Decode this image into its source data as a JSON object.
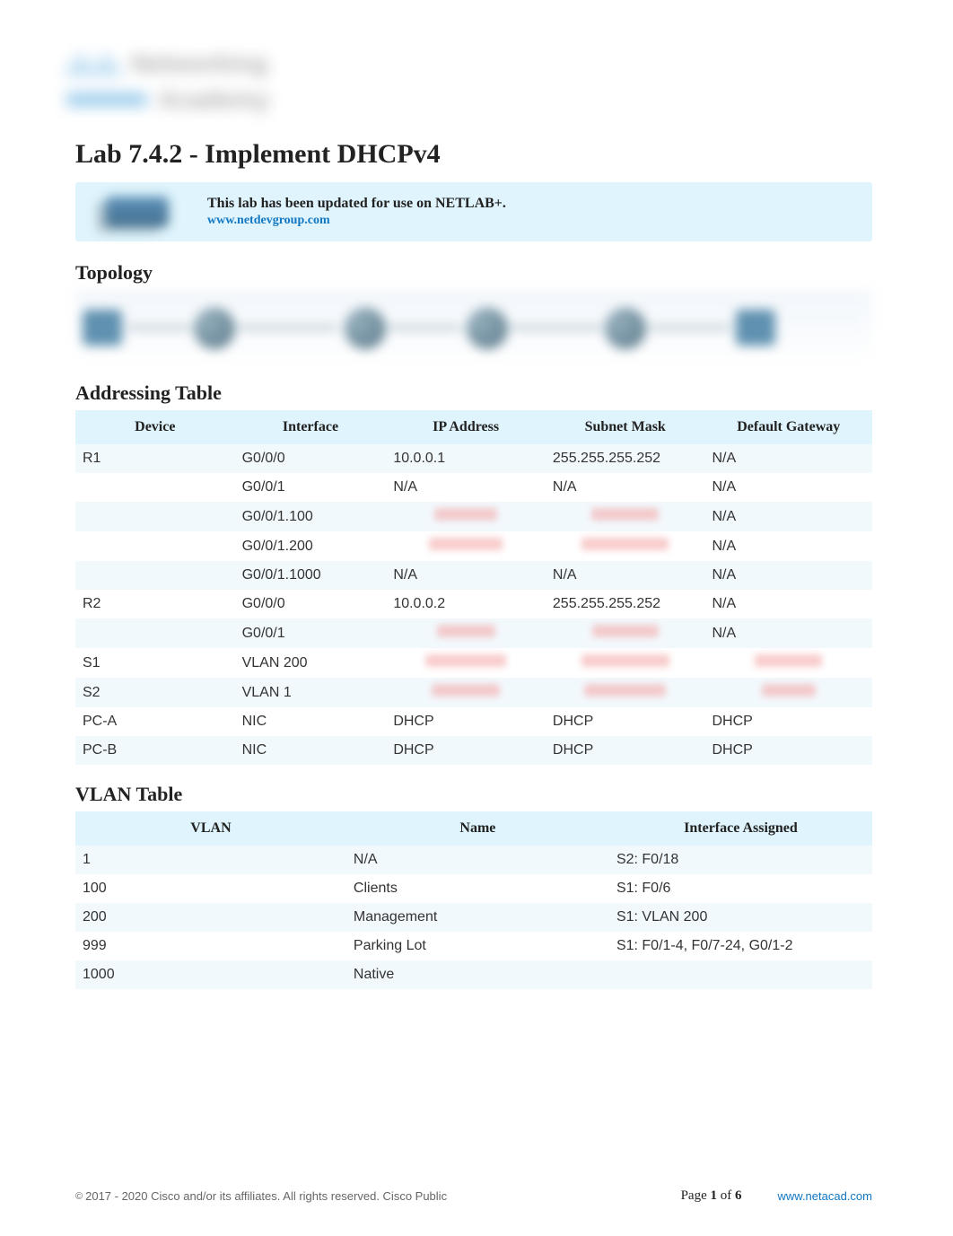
{
  "logo": {
    "word1": "Networking",
    "word2": "Academy"
  },
  "title": "Lab 7.4.2 - Implement DHCPv4",
  "notice": {
    "line": "This lab has been updated for use on NETLAB+.",
    "link": "www.netdevgroup.com"
  },
  "sections": {
    "topology": "Topology",
    "addressing": "Addressing Table",
    "vlan": "VLAN Table"
  },
  "addr_table": {
    "headers": [
      "Device",
      "Interface",
      "IP Address",
      "Subnet Mask",
      "Default Gateway"
    ],
    "rows": [
      {
        "device": "R1",
        "interface": "G0/0/0",
        "ip": "10.0.0.1",
        "mask": "255.255.255.252",
        "gw": "N/A",
        "alt": true
      },
      {
        "device": "",
        "interface": "G0/0/1",
        "ip": "N/A",
        "mask": "N/A",
        "gw": "N/A",
        "alt": false
      },
      {
        "device": "",
        "interface": "G0/0/1.100",
        "ip": "__REDACT__",
        "mask": "__REDACT__",
        "gw": "N/A",
        "alt": true
      },
      {
        "device": "",
        "interface": "G0/0/1.200",
        "ip": "__REDACT__",
        "mask": "__REDACT__",
        "gw": "N/A",
        "alt": false
      },
      {
        "device": "",
        "interface": "G0/0/1.1000",
        "ip": "N/A",
        "mask": "N/A",
        "gw": "N/A",
        "alt": true
      },
      {
        "device": "R2",
        "interface": "G0/0/0",
        "ip": "10.0.0.2",
        "mask": "255.255.255.252",
        "gw": "N/A",
        "alt": false
      },
      {
        "device": "",
        "interface": "G0/0/1",
        "ip": "__REDACT__",
        "mask": "__REDACT__",
        "gw": "N/A",
        "alt": true
      },
      {
        "device": "S1",
        "interface": "VLAN 200",
        "ip": "__REDACT__",
        "mask": "__REDACT__",
        "gw": "__REDACT__",
        "alt": false
      },
      {
        "device": "S2",
        "interface": "VLAN 1",
        "ip": "__REDACT__",
        "mask": "__REDACT__",
        "gw": "__REDACT__",
        "alt": true
      },
      {
        "device": "PC-A",
        "interface": "NIC",
        "ip": "DHCP",
        "mask": "DHCP",
        "gw": "DHCP",
        "alt": false
      },
      {
        "device": "PC-B",
        "interface": "NIC",
        "ip": "DHCP",
        "mask": "DHCP",
        "gw": "DHCP",
        "alt": true
      }
    ]
  },
  "vlan_table": {
    "headers": [
      "VLAN",
      "Name",
      "Interface Assigned"
    ],
    "rows": [
      {
        "vlan": "1",
        "name": "N/A",
        "iface": "S2: F0/18",
        "alt": true
      },
      {
        "vlan": "100",
        "name": "Clients",
        "iface": "S1: F0/6",
        "alt": false
      },
      {
        "vlan": "200",
        "name": "Management",
        "iface": "S1: VLAN 200",
        "alt": true
      },
      {
        "vlan": "999",
        "name": "Parking Lot",
        "iface": "S1: F0/1-4, F0/7-24, G0/1-2",
        "alt": false
      },
      {
        "vlan": "1000",
        "name": "Native",
        "iface": "",
        "alt": true
      }
    ]
  },
  "footer": {
    "copyright": "2017 - 2020 Cisco and/or its affiliates. All rights reserved. Cisco Public",
    "page_prefix": "Page ",
    "page_current": "1",
    "page_of": " of ",
    "page_total": "6",
    "site": "www.netacad.com"
  }
}
